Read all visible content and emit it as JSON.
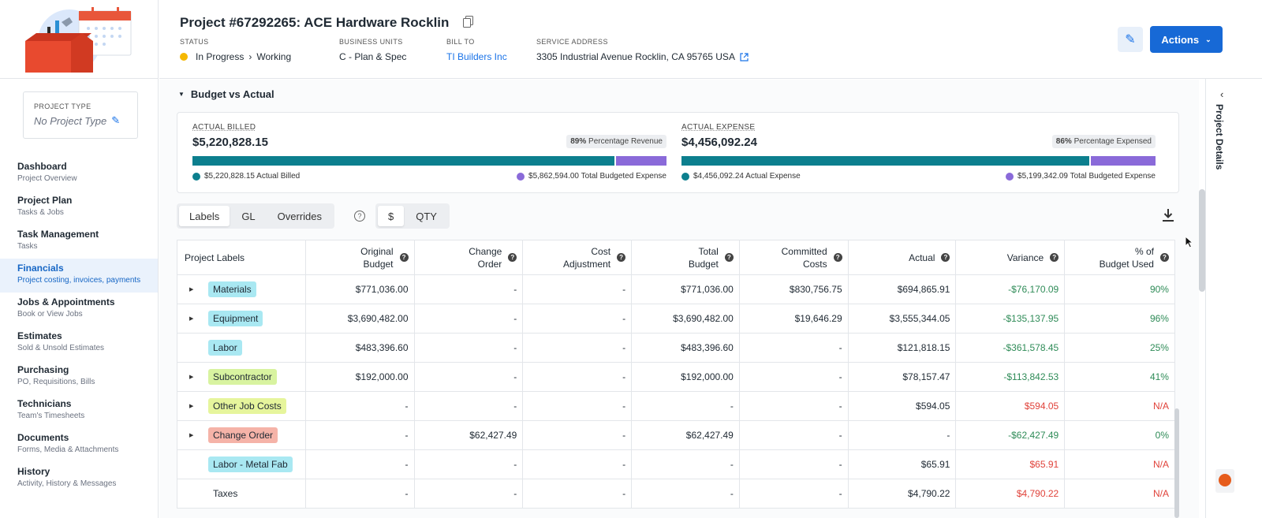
{
  "app": {
    "logo": "toolbox-calendar-logo"
  },
  "project_type": {
    "label": "PROJECT TYPE",
    "value": "No Project Type"
  },
  "nav": [
    {
      "title": "Dashboard",
      "sub": "Project Overview"
    },
    {
      "title": "Project Plan",
      "sub": "Tasks & Jobs"
    },
    {
      "title": "Task Management",
      "sub": "Tasks"
    },
    {
      "title": "Financials",
      "sub": "Project costing, invoices, payments"
    },
    {
      "title": "Jobs & Appointments",
      "sub": "Book or View Jobs"
    },
    {
      "title": "Estimates",
      "sub": "Sold & Unsold Estimates"
    },
    {
      "title": "Purchasing",
      "sub": "PO, Requisitions, Bills"
    },
    {
      "title": "Technicians",
      "sub": "Team's Timesheets"
    },
    {
      "title": "Documents",
      "sub": "Forms, Media & Attachments"
    },
    {
      "title": "History",
      "sub": "Activity, History & Messages"
    }
  ],
  "header": {
    "title": "Project #67292265:  ACE Hardware Rocklin",
    "status_label": "STATUS",
    "status_value": "In Progress",
    "status_sub": "Working",
    "bu_label": "BUSINESS UNITS",
    "bu_value": "C - Plan & Spec",
    "bill_label": "BILL TO",
    "bill_value": "TI Builders Inc",
    "addr_label": "SERVICE ADDRESS",
    "addr_value": "3305 Industrial Avenue Rocklin, CA 95765 USA",
    "actions_label": "Actions"
  },
  "rail": {
    "label": "Project Details"
  },
  "section": {
    "title": "Budget vs Actual"
  },
  "summary": {
    "billed": {
      "label": "ACTUAL BILLED",
      "amount": "$5,220,828.15",
      "pct": "89%",
      "pct_label": "Percentage Revenue",
      "fill": 0.89,
      "legend_a": "$5,220,828.15 Actual Billed",
      "legend_b": "$5,862,594.00 Total Budgeted Expense"
    },
    "expense": {
      "label": "ACTUAL EXPENSE",
      "amount": "$4,456,092.24",
      "pct": "86%",
      "pct_label": "Percentage Expensed",
      "fill": 0.86,
      "legend_a": "$4,456,092.24 Actual Expense",
      "legend_b": "$5,199,342.09 Total Budgeted Expense"
    },
    "colors": {
      "actual": "#0c7f8e",
      "budget": "#8a6ad9"
    }
  },
  "view_tabs": [
    "Labels",
    "GL",
    "Overrides"
  ],
  "unit_tabs": [
    "$",
    "QTY"
  ],
  "table": {
    "headers": [
      [
        "Project Labels"
      ],
      [
        "Original",
        "Budget"
      ],
      [
        "Change",
        "Order"
      ],
      [
        "Cost",
        "Adjustment"
      ],
      [
        "Total",
        "Budget"
      ],
      [
        "Committed",
        "Costs"
      ],
      [
        "Actual"
      ],
      [
        "Variance"
      ],
      [
        "% of",
        "Budget Used"
      ]
    ],
    "rows": [
      {
        "label": "Materials",
        "color": "#a9e8f2",
        "expand": true,
        "cells": [
          "$771,036.00",
          "-",
          "-",
          "$771,036.00",
          "$830,756.75",
          "$694,865.91",
          "-$76,170.09",
          "90%"
        ],
        "tone": "pos"
      },
      {
        "label": "Equipment",
        "color": "#a9e8f2",
        "expand": true,
        "cells": [
          "$3,690,482.00",
          "-",
          "-",
          "$3,690,482.00",
          "$19,646.29",
          "$3,555,344.05",
          "-$135,137.95",
          "96%"
        ],
        "tone": "pos"
      },
      {
        "label": "Labor",
        "color": "#a9e8f2",
        "expand": false,
        "cells": [
          "$483,396.60",
          "-",
          "-",
          "$483,396.60",
          "-",
          "$121,818.15",
          "-$361,578.45",
          "25%"
        ],
        "tone": "pos"
      },
      {
        "label": "Subcontractor",
        "color": "#d8f3a0",
        "expand": true,
        "cells": [
          "$192,000.00",
          "-",
          "-",
          "$192,000.00",
          "-",
          "$78,157.47",
          "-$113,842.53",
          "41%"
        ],
        "tone": "pos"
      },
      {
        "label": "Other Job Costs",
        "color": "#e6f59c",
        "expand": true,
        "cells": [
          "-",
          "-",
          "-",
          "-",
          "-",
          "$594.05",
          "$594.05",
          "N/A"
        ],
        "tone": "neg"
      },
      {
        "label": "Change Order",
        "color": "#f5b3a8",
        "expand": true,
        "cells": [
          "-",
          "$62,427.49",
          "-",
          "$62,427.49",
          "-",
          "-",
          "-$62,427.49",
          "0%"
        ],
        "tone": "pos"
      },
      {
        "label": "Labor - Metal Fab",
        "color": "#a9e8f2",
        "expand": false,
        "cells": [
          "-",
          "-",
          "-",
          "-",
          "-",
          "$65.91",
          "$65.91",
          "N/A"
        ],
        "tone": "neg"
      },
      {
        "label": "Taxes",
        "color": "",
        "expand": false,
        "cells": [
          "-",
          "-",
          "-",
          "-",
          "-",
          "$4,790.22",
          "$4,790.22",
          "N/A"
        ],
        "tone": "neg"
      }
    ]
  }
}
